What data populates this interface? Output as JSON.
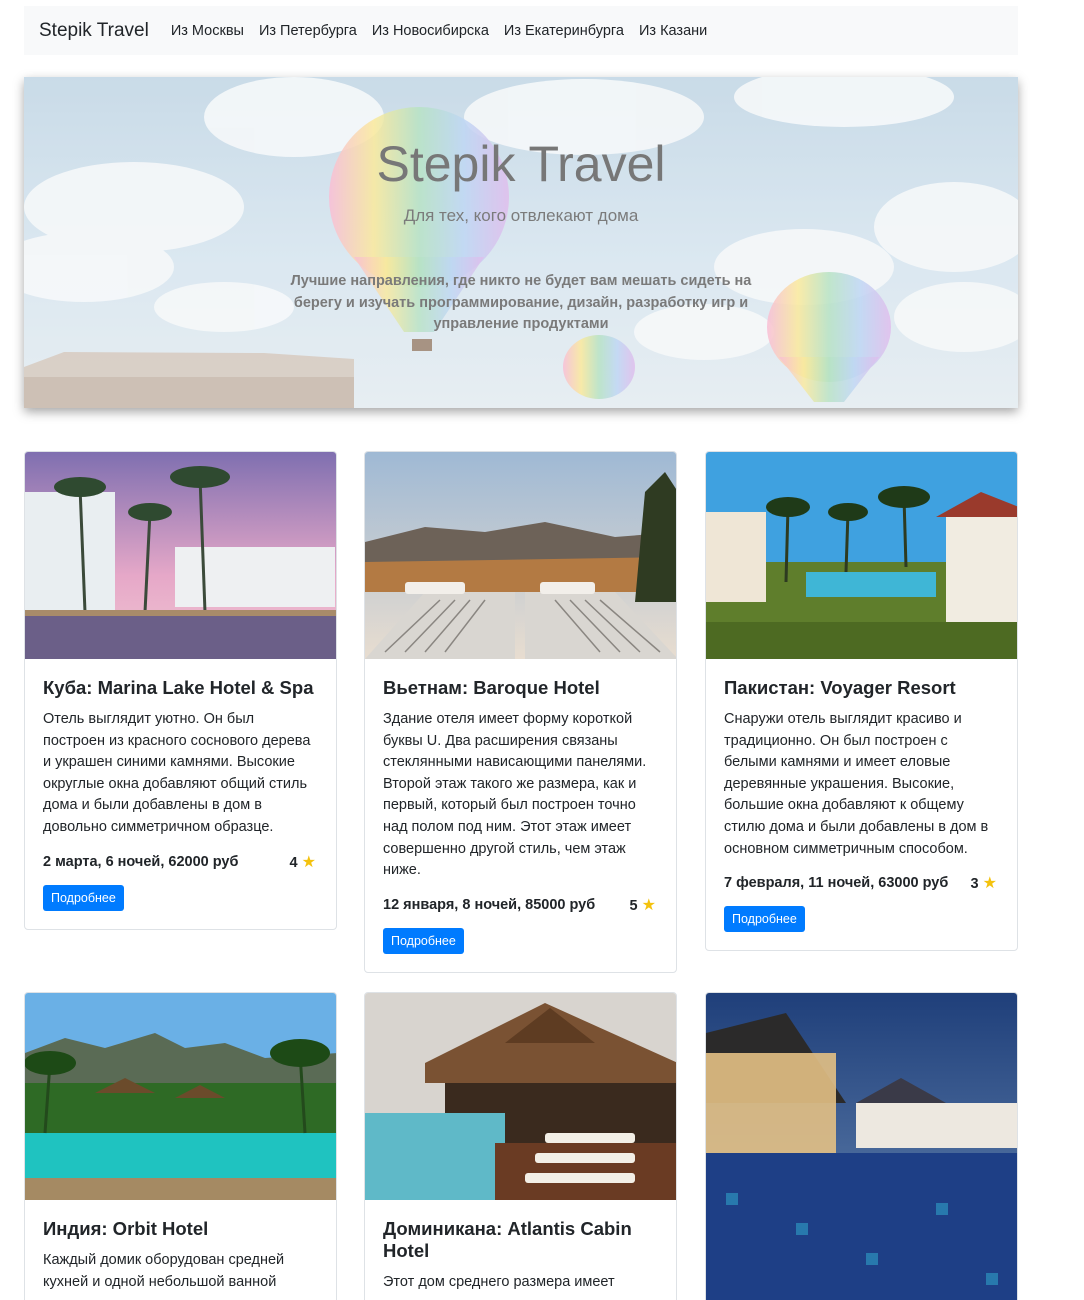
{
  "nav": {
    "brand": "Stepik Travel",
    "links": [
      "Из Москвы",
      "Из Петербурга",
      "Из Новосибирска",
      "Из Екатеринбурга",
      "Из Казани"
    ]
  },
  "hero": {
    "title": "Stepik Travel",
    "subtitle": "Для тех, кого отвлекают дома",
    "lead": "Лучшие направления, где никто не будет вам мешать сидеть на берегу и изучать программирование, дизайн, разработку игр и управление продуктами"
  },
  "tours": [
    {
      "title": "Куба: Marina Lake Hotel & Spa",
      "description": "Отель выглядит уютно. Он был построен из красного соснового дерева и украшен синими камнями. Высокие округлые окна добавляют общий стиль дома и были добавлены в дом в довольно симметричном образце.",
      "info": "2 марта, 6 ночей, 62000 руб",
      "stars": "4",
      "star_icon": "★",
      "button": "Подробнее"
    },
    {
      "title": "Вьетнам: Baroque Hotel",
      "description": "Здание отеля имеет форму короткой буквы U. Два расширения связаны стеклянными нависающими панелями. Второй этаж такого же размера, как и первый, который был построен точно над полом под ним. Этот этаж имеет совершенно другой стиль, чем этаж ниже.",
      "info": "12 января, 8 ночей, 85000 руб",
      "stars": "5",
      "star_icon": "★",
      "button": "Подробнее"
    },
    {
      "title": "Пакистан: Voyager Resort",
      "description": "Снаружи отель выглядит красиво и традиционно. Он был построен с белыми камнями и имеет еловые деревянные украшения. Высокие, большие окна добавляют к общему стилю дома и были добавлены в дом в основном симметричным способом.",
      "info": "7 февраля, 11 ночей, 63000 руб",
      "stars": "3",
      "star_icon": "★",
      "button": "Подробнее"
    },
    {
      "title": "Индия: Orbit Hotel",
      "description": "Каждый домик оборудован средней кухней и одной небольшой ванной",
      "info": "",
      "stars": "",
      "star_icon": "",
      "button": ""
    },
    {
      "title": "Доминикана: Atlantis Cabin Hotel",
      "description": "Этот дом среднего размера имеет",
      "info": "",
      "stars": "",
      "star_icon": "",
      "button": ""
    }
  ]
}
